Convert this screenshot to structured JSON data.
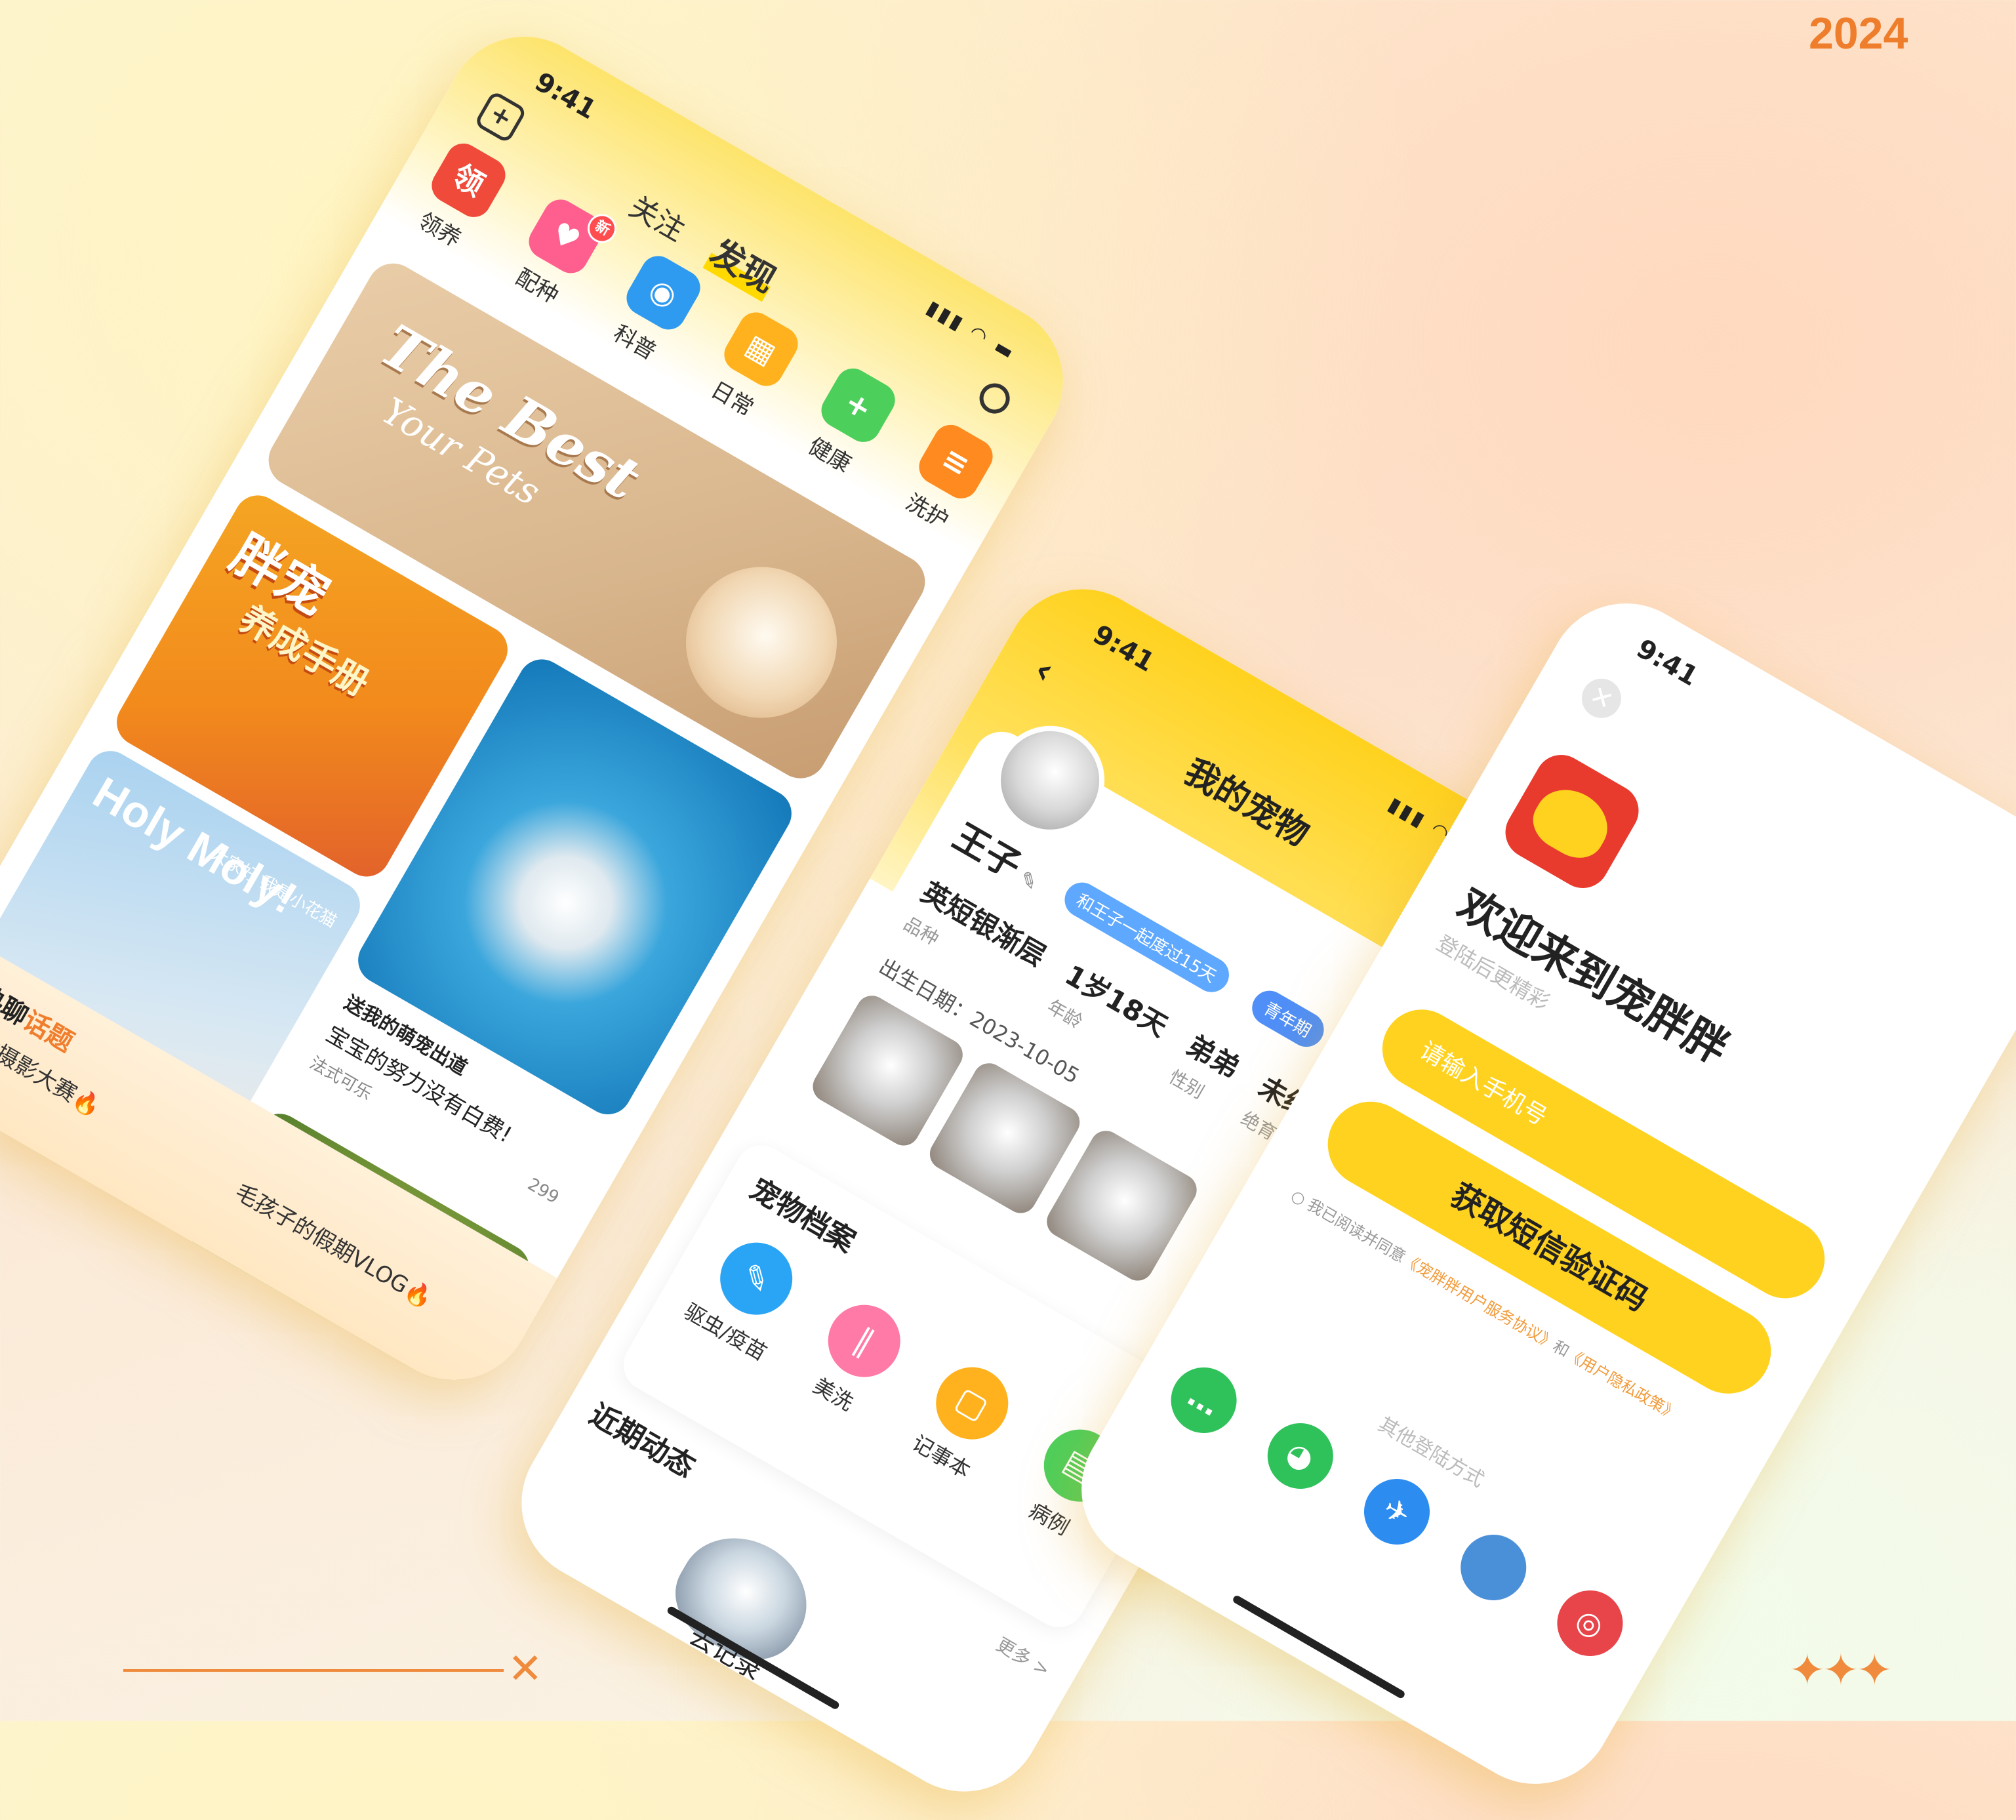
{
  "page": {
    "year": "2024"
  },
  "decorations": {
    "cross": "✕",
    "stars": "✦✦✦"
  },
  "discover_screen": {
    "time": "9:41",
    "signal": "▮▮▮ ◠ ▬",
    "add_icon": "+",
    "tabs": [
      {
        "label": "关注",
        "active": false
      },
      {
        "label": "发现",
        "active": true
      }
    ],
    "categories": [
      {
        "label": "领养",
        "glyph": "领",
        "color": "#ef4a3a",
        "badge": ""
      },
      {
        "label": "配种",
        "glyph": "♥",
        "color": "#ff5f8f",
        "badge": "新"
      },
      {
        "label": "科普",
        "glyph": "◉",
        "color": "#2f9bf0",
        "badge": ""
      },
      {
        "label": "日常",
        "glyph": "▦",
        "color": "#ffb21e",
        "badge": ""
      },
      {
        "label": "健康",
        "glyph": "+",
        "color": "#4ccf5b",
        "badge": ""
      },
      {
        "label": "洗护",
        "glyph": "≡",
        "color": "#ff8a1f",
        "badge": ""
      }
    ],
    "banner": {
      "line1": "The Best",
      "line2": "Your Pets"
    },
    "cards": {
      "guide": {
        "title": "胖宠",
        "subtitle": "养成手册"
      },
      "cat": {
        "title": "Holy Moly!",
        "subtitle": "大家好 我是小花猫"
      },
      "post": {
        "title": "送我的萌宠出道",
        "text": "宝宝的努力没有白费!",
        "author": "法式可乐",
        "likes": "299"
      }
    },
    "hot": {
      "title_prefix": "热聊",
      "title_accent": "话题",
      "items": [
        "宠物摄影大赛🔥",
        "毛孩子的假期VLOG🔥"
      ]
    }
  },
  "pet_screen": {
    "time": "9:41",
    "signal": "▮▮▮ ◠ ▬",
    "back_icon": "‹",
    "title": "我的宠物",
    "pet": {
      "name": "王子",
      "edit_icon": "✎",
      "chip_days": "和王子一起度过15天",
      "chip_stage": "青年期",
      "stats": [
        {
          "value": "英短银渐层",
          "label": "品种"
        },
        {
          "value": "1岁18天",
          "label": "年龄"
        },
        {
          "value": "弟弟",
          "label": "性别"
        },
        {
          "value": "未绝育",
          "label": "绝育情况"
        }
      ],
      "birthday": "出生日期：2023-10-05",
      "plus_icon": "+"
    },
    "archive": {
      "title": "宠物档案",
      "items": [
        {
          "label": "驱虫/疫苗",
          "glyph": "✎",
          "color": "#2aa5f5"
        },
        {
          "label": "美洗",
          "glyph": "∥",
          "color": "#ff7aa6"
        },
        {
          "label": "记事本",
          "glyph": "▢",
          "color": "#ffb21e"
        },
        {
          "label": "病例",
          "glyph": "▤",
          "color": "#4ccf5b"
        }
      ]
    },
    "recent": {
      "title": "近期动态",
      "more": "更多 >",
      "action": "去记录"
    }
  },
  "login_screen": {
    "time": "9:41",
    "close_icon": "✕",
    "title": "欢迎来到宠胖胖",
    "subtitle": "登陆后更精彩",
    "phone_placeholder": "请输入手机号",
    "submit": "获取短信验证码",
    "agreement": {
      "prefix": "我已阅读并同意",
      "link1": "《宠胖胖用户服务协议》",
      "and": "和",
      "link2": "《用户隐私政策》"
    },
    "other_methods": "其他登陆方式",
    "socials": [
      {
        "name": "imessage-icon",
        "glyph": "…",
        "color": "#2fc25b"
      },
      {
        "name": "wechat-icon",
        "glyph": "◕",
        "color": "#2fc25b"
      },
      {
        "name": "pinduoduo-icon",
        "glyph": "✈",
        "color": "#2d8cf0"
      },
      {
        "name": "apple-icon",
        "glyph": "",
        "color": "#4a90d9"
      },
      {
        "name": "weibo-icon",
        "glyph": "◎",
        "color": "#e8454b"
      }
    ]
  }
}
